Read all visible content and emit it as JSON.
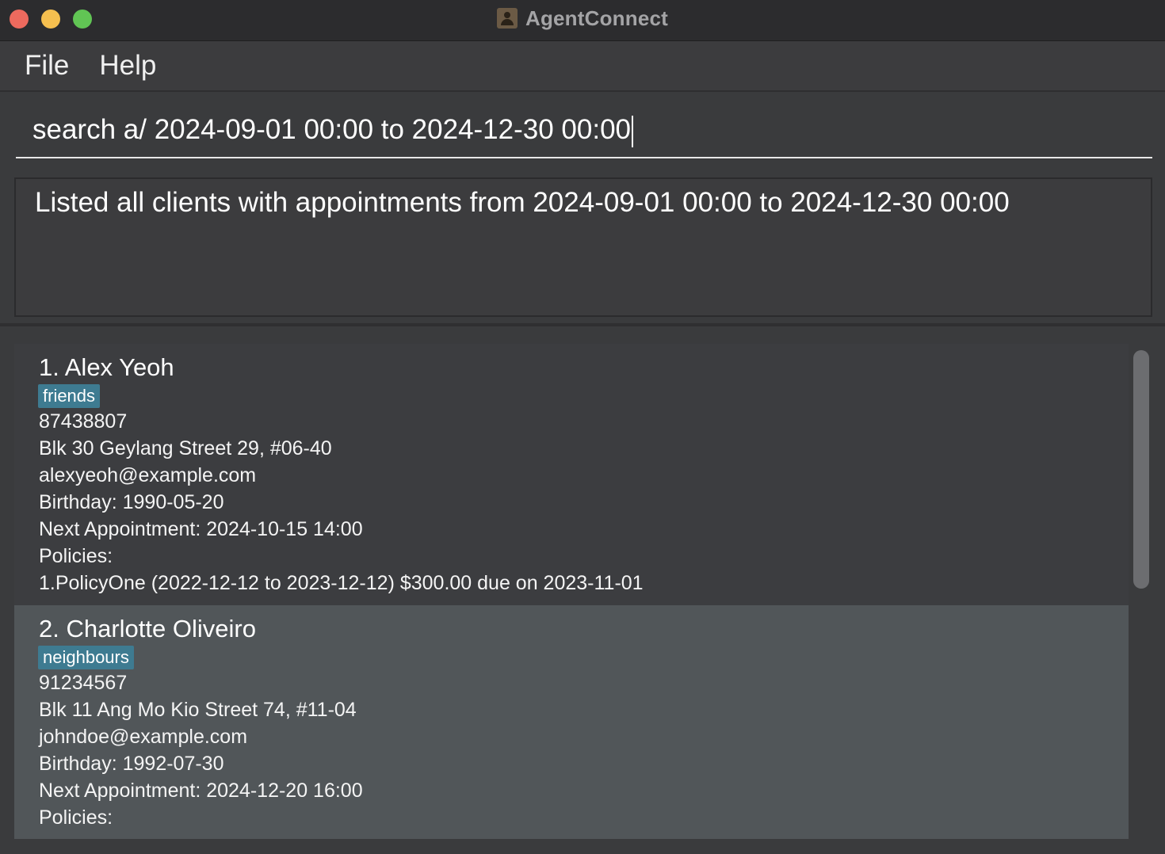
{
  "window": {
    "title": "AgentConnect"
  },
  "menu": {
    "file": "File",
    "help": "Help"
  },
  "command": {
    "value": "search a/ 2024-09-01 00:00 to 2024-12-30 00:00"
  },
  "result": {
    "message": "Listed all clients with appointments from 2024-09-01 00:00 to 2024-12-30 00:00"
  },
  "persons": [
    {
      "name": "1. Alex Yeoh",
      "tag": "friends",
      "phone": "87438807",
      "address": "Blk 30 Geylang Street 29, #06-40",
      "email": "alexyeoh@example.com",
      "birthday": "Birthday: 1990-05-20",
      "appointment": "Next Appointment: 2024-10-15 14:00",
      "policies_label": "Policies:",
      "policy_1": "1.PolicyOne (2022-12-12 to 2023-12-12) $300.00 due on 2023-11-01"
    },
    {
      "name": "2. Charlotte Oliveiro",
      "tag": "neighbours",
      "phone": "91234567",
      "address": "Blk 11 Ang Mo Kio Street 74, #11-04",
      "email": "johndoe@example.com",
      "birthday": "Birthday: 1992-07-30",
      "appointment": "Next Appointment: 2024-12-20 16:00",
      "policies_label": "Policies:"
    }
  ],
  "colors": {
    "tag_background": "#3e7b91",
    "selected_card": "#515659",
    "close_button": "#ed6a5e",
    "minimize_button": "#f5bf4f",
    "maximize_button": "#61c554"
  }
}
